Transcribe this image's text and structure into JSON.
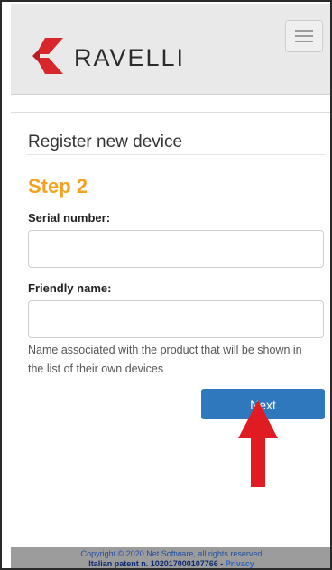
{
  "header": {
    "brand": "RAVELLI",
    "menu_icon": "hamburger-menu-icon"
  },
  "form": {
    "title": "Register new device",
    "step": "Step 2",
    "serial_label": "Serial number:",
    "serial_value": "",
    "friendly_label": "Friendly name:",
    "friendly_value": "",
    "help_text": "Name associated with the product that will be shown in the list of their own devices",
    "next_label": "Next"
  },
  "annotation": {
    "arrow_icon": "red-up-arrow-icon",
    "color": "#e01b22"
  },
  "footer": {
    "copyright": "Copyright © 2020 Net Software, all rights reserved",
    "patent": "Italian patent n. 102017000107766 - ",
    "privacy": "Privacy"
  },
  "colors": {
    "accent": "#f5a11c",
    "button": "#2f78bd",
    "logo": "#d8262b"
  }
}
